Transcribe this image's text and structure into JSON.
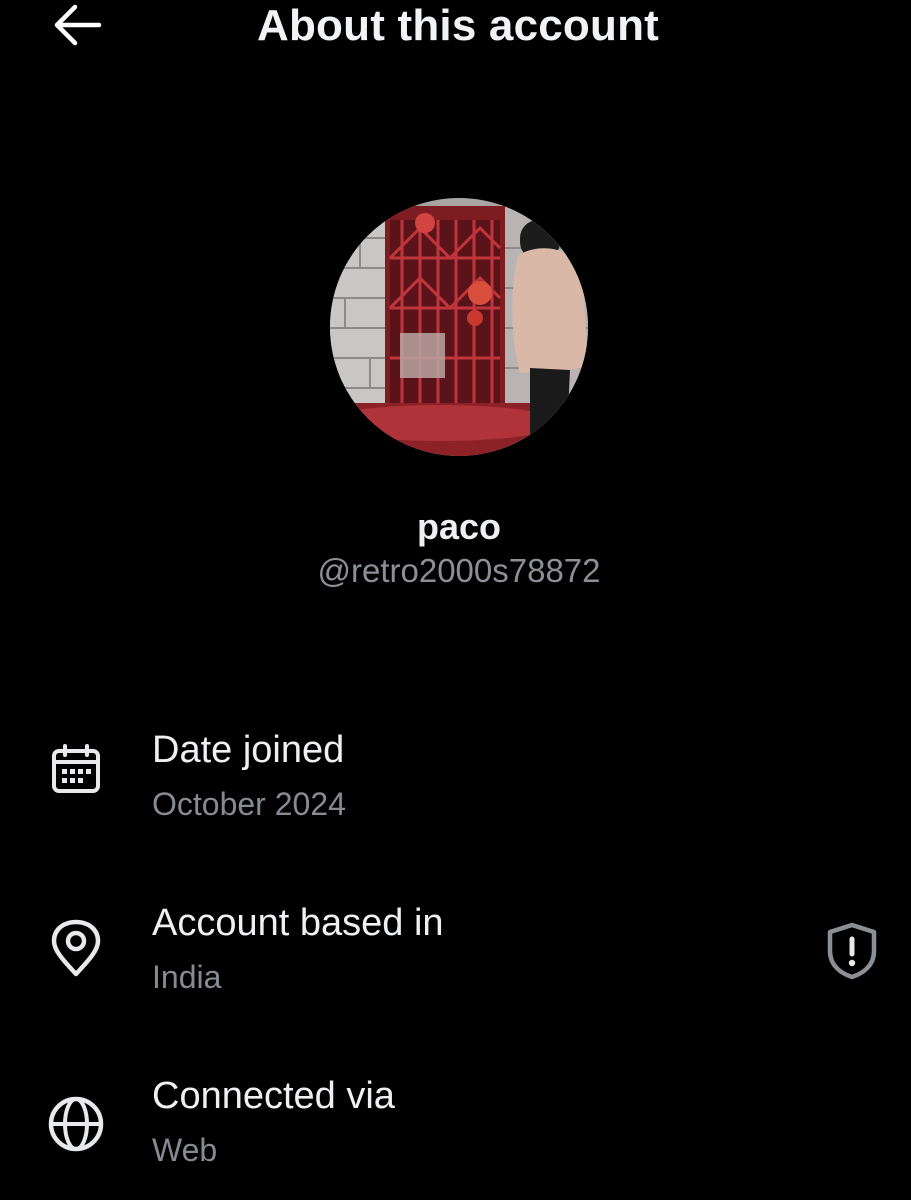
{
  "header": {
    "title": "About this account",
    "back_icon": "arrow-left-icon"
  },
  "profile": {
    "display_name": "paco",
    "handle": "@retro2000s78872"
  },
  "info_rows": [
    {
      "label": "Date joined",
      "value": "October 2024",
      "icon": "calendar-icon"
    },
    {
      "label": "Account based in",
      "value": "India",
      "icon": "location-pin-icon",
      "trailing_icon": "shield-alert-icon"
    },
    {
      "label": "Connected via",
      "value": "Web",
      "icon": "globe-icon"
    }
  ],
  "colors": {
    "background": "#000000",
    "primary_text": "#e7e9ea",
    "secondary_text": "#868b90"
  }
}
